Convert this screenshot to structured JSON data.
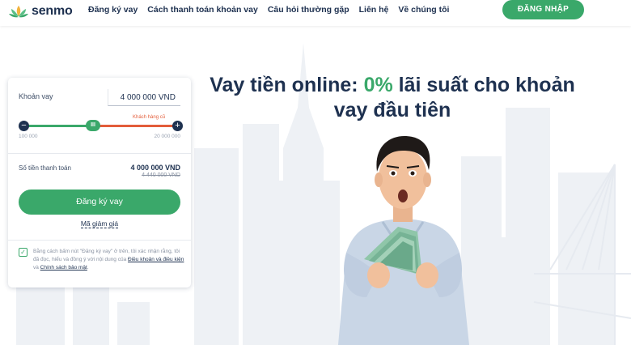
{
  "header": {
    "logo_text": "senmo",
    "nav": [
      "Đăng ký vay",
      "Cách thanh toán khoản vay",
      "Câu hỏi thường gặp",
      "Liên hệ",
      "Về chúng tôi"
    ],
    "login_label": "ĐĂNG NHẬP"
  },
  "hero": {
    "title_before": "Vay tiền online: ",
    "title_accent": "0%",
    "title_after": " lãi suất cho khoản vay đầu tiên"
  },
  "loan_form": {
    "amount_label": "Khoản vay",
    "amount_value": "4 000 000 VND",
    "slider": {
      "hint": "Khách hàng cũ",
      "min_label": "100 000",
      "max_label": "20 000 000",
      "thumb_glyph": "III",
      "minus_glyph": "−",
      "plus_glyph": "+"
    },
    "payment_label": "Số tiền thanh toán",
    "payment_value": "4 000 000 VND",
    "payment_old": "4 440 000 VND",
    "apply_label": "Đăng ký vay",
    "promo_label": "Mã giảm giá",
    "agree_text": "Bằng cách bấm nút \"Đăng ký vay\" ở trên, tôi xác nhận rằng, tôi đã đọc, hiểu và đồng ý với nội dung của ",
    "terms_link": "Điều khoản và điều kiện",
    "agree_and": " và ",
    "privacy_link": "Chính sách bảo mật",
    "agree_end": ".",
    "checkbox_checked": true
  },
  "icons": {
    "logo": "lotus-icon",
    "minus": "minus-icon",
    "plus": "plus-icon",
    "checkbox": "check-icon"
  },
  "colors": {
    "brand_green": "#3aa86a",
    "navy": "#1e3150",
    "accent_red": "#e35d3a",
    "skyline": "#eef1f5"
  }
}
